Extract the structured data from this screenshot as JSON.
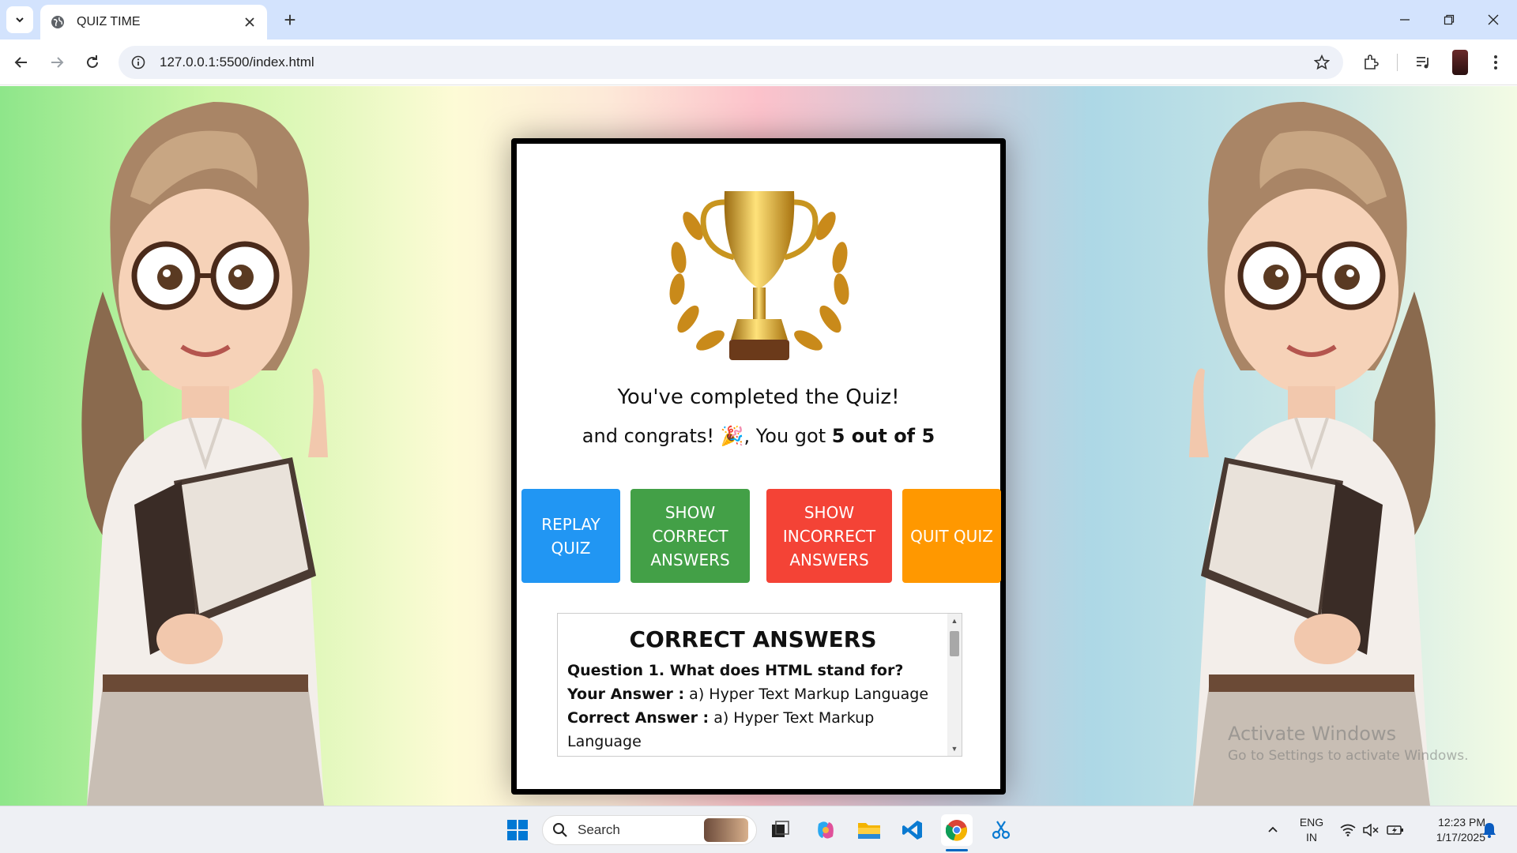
{
  "browser": {
    "tab_title": "QUIZ TIME",
    "new_tab": "+",
    "url": "127.0.0.1:5500/index.html"
  },
  "quiz": {
    "completed_text": "You've completed the Quiz!",
    "score_prefix": "and congrats! 🎉, You got ",
    "score_value": "5 out of 5",
    "buttons": {
      "replay": "REPLAY QUIZ",
      "show_correct": "SHOW CORRECT ANSWERS",
      "show_incorrect": "SHOW INCORRECT ANSWERS",
      "quit": "QUIT QUIZ"
    },
    "answers_panel": {
      "title": "CORRECT ANSWERS",
      "items": [
        {
          "question": "Question 1. What does HTML stand for?",
          "your_answer_label": "Your Answer :",
          "your_answer": " a) Hyper Text Markup Language",
          "correct_answer_label": "Correct Answer :",
          "correct_answer": " a) Hyper Text Markup Language"
        }
      ]
    }
  },
  "watermark": {
    "line1": "Activate Windows",
    "line2": "Go to Settings to activate Windows."
  },
  "taskbar": {
    "search_label": "Search",
    "lang_line1": "ENG",
    "lang_line2": "IN",
    "time": "12:23 PM",
    "date": "1/17/2025"
  },
  "colors": {
    "replay": "#2196f3",
    "show_correct": "#43a047",
    "show_incorrect": "#f44336",
    "quit": "#ff9800"
  }
}
